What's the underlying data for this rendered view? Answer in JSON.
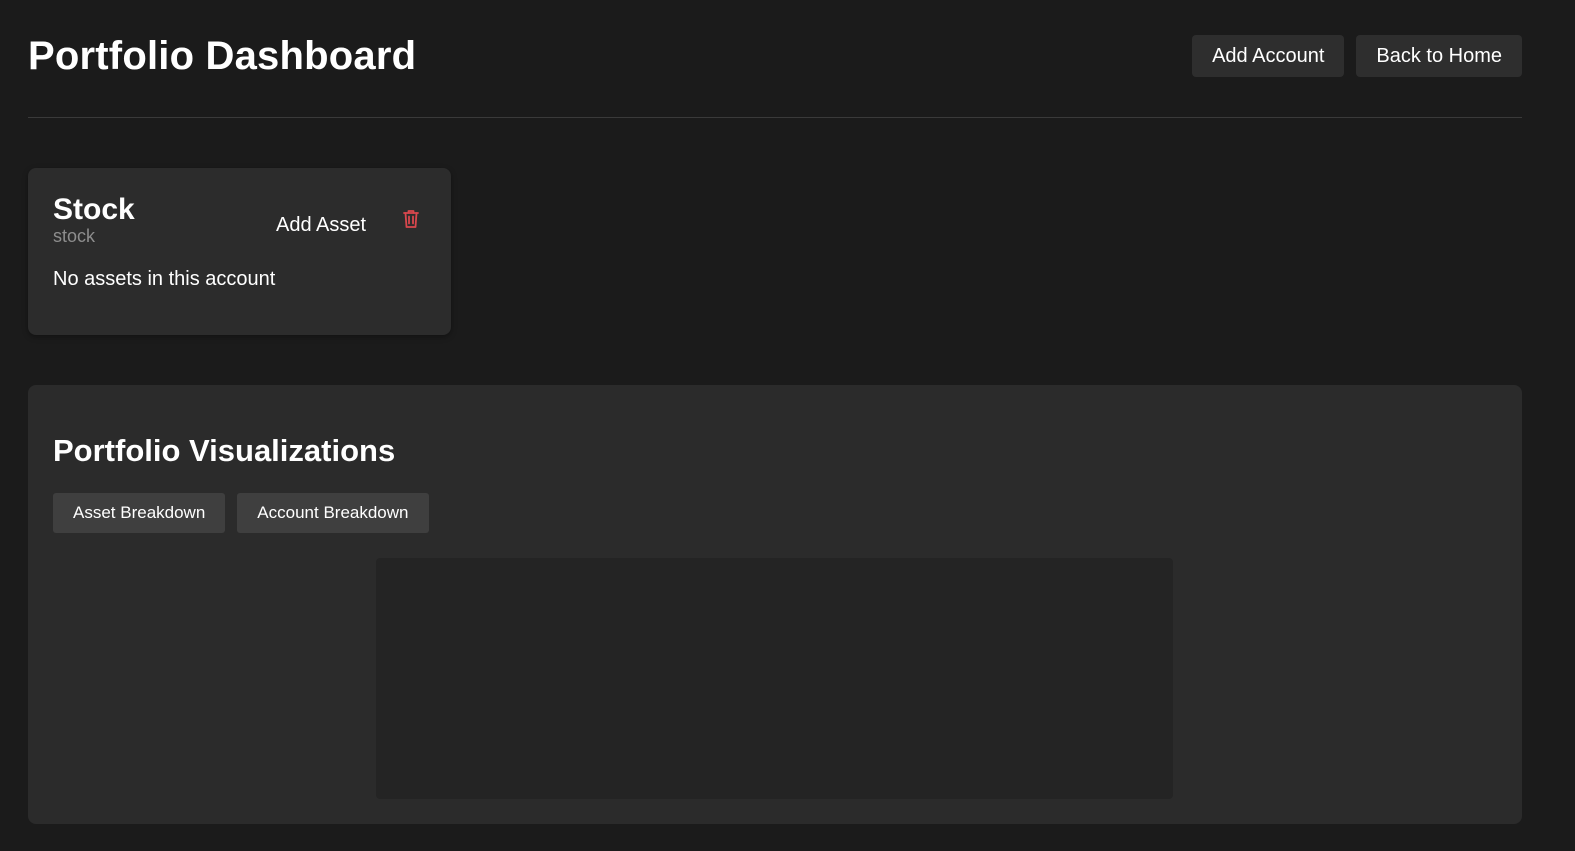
{
  "header": {
    "title": "Portfolio Dashboard",
    "add_account_label": "Add Account",
    "back_home_label": "Back to Home"
  },
  "accounts": [
    {
      "name": "Stock",
      "type": "stock",
      "add_asset_label": "Add Asset",
      "delete_icon": "trash-icon",
      "empty_message": "No assets in this account"
    }
  ],
  "visualizations": {
    "title": "Portfolio Visualizations",
    "tabs": [
      {
        "label": "Asset Breakdown"
      },
      {
        "label": "Account Breakdown"
      }
    ]
  },
  "colors": {
    "background": "#1b1b1b",
    "card": "#2c2c2c",
    "danger": "#d9474d"
  }
}
